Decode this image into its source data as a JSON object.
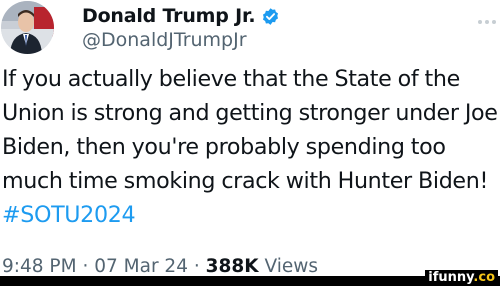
{
  "author": {
    "display_name": "Donald Trump Jr.",
    "handle": "@DonaldJTrumpJr",
    "verified": true,
    "avatar_icon": "profile-photo"
  },
  "tweet": {
    "text": "If you actually believe that the State of the Union is strong and getting stronger under Joe Biden, then you're probably spending too much time smoking crack with Hunter Biden!",
    "hashtag": "#SOTU2024"
  },
  "meta": {
    "time": "9:48 PM",
    "sep1": "·",
    "date": "07 Mar 24",
    "sep2": "·",
    "views_count": "388K",
    "views_label": "Views"
  },
  "watermark": {
    "brand": "ifunny",
    "suffix": ".co"
  },
  "colors": {
    "link": "#1d9bf0",
    "verified": "#1d9bf0",
    "secondary_text": "#536471"
  }
}
